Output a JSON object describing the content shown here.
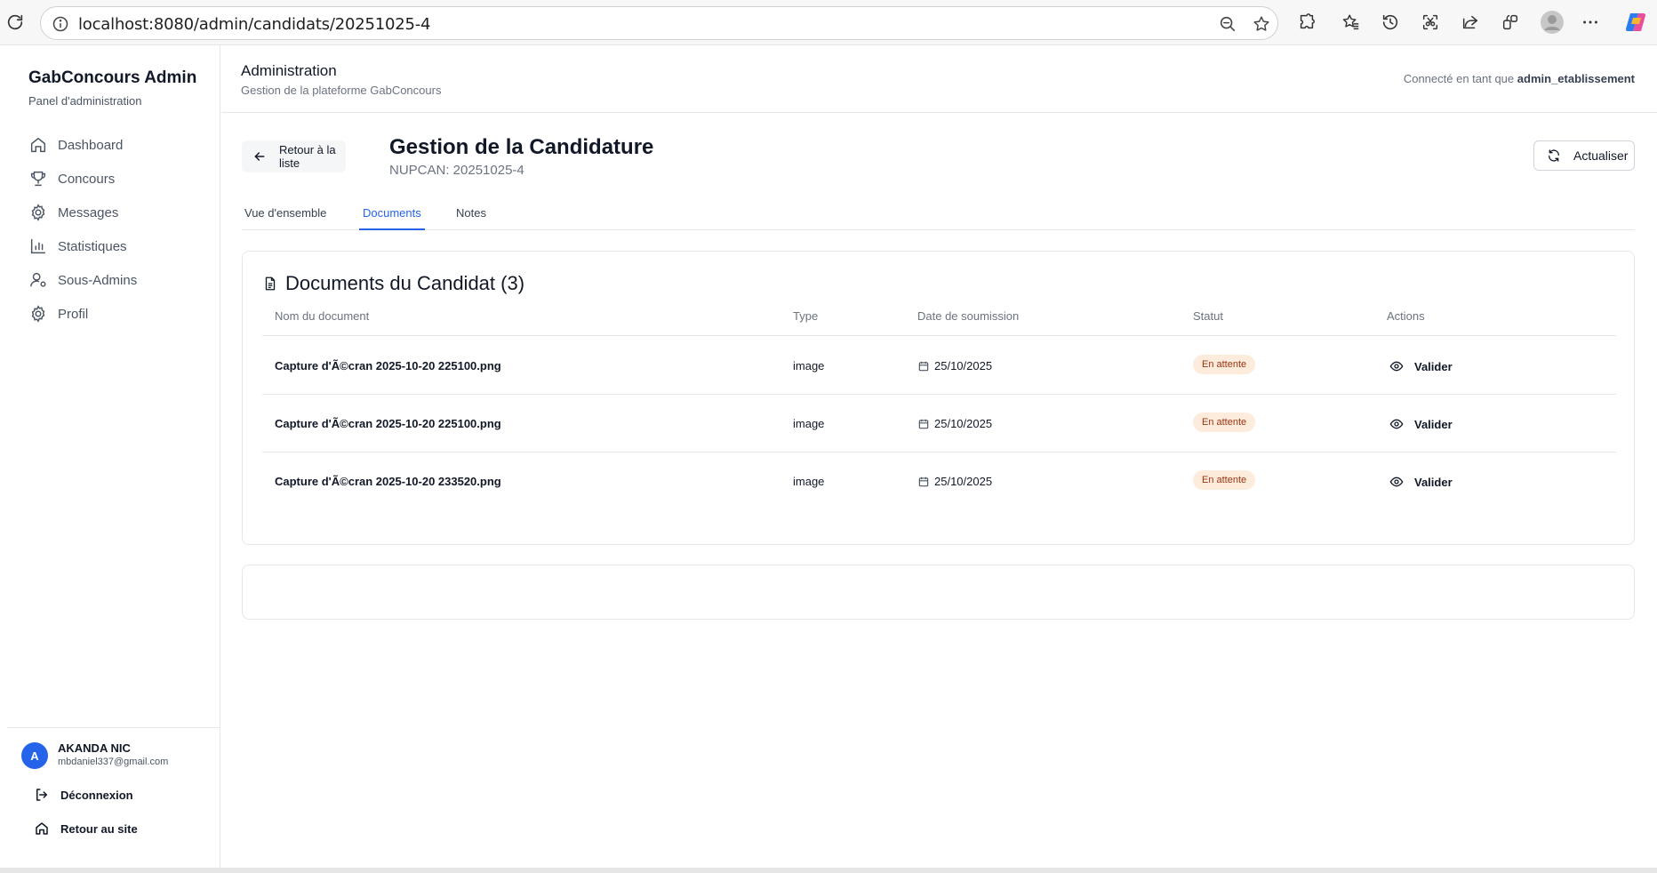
{
  "browser": {
    "url": "localhost:8080/admin/candidats/20251025-4"
  },
  "sidebar": {
    "brand_title": "GabConcours Admin",
    "brand_subtitle": "Panel d'administration",
    "items": [
      {
        "label": "Dashboard",
        "icon": "home-icon"
      },
      {
        "label": "Concours",
        "icon": "trophy-icon"
      },
      {
        "label": "Messages",
        "icon": "gear-icon"
      },
      {
        "label": "Statistiques",
        "icon": "bar-chart-icon"
      },
      {
        "label": "Sous-Admins",
        "icon": "user-cog-icon"
      },
      {
        "label": "Profil",
        "icon": "gear-icon"
      }
    ],
    "user": {
      "initial": "A",
      "name": "AKANDA NIC",
      "email": "mbdaniel337@gmail.com"
    },
    "logout_label": "Déconnexion",
    "back_to_site_label": "Retour au site"
  },
  "header": {
    "title": "Administration",
    "subtitle": "Gestion de la plateforme GabConcours",
    "connected_prefix": "Connecté en tant que",
    "connected_user": "admin_etablissement"
  },
  "page": {
    "back_label": "Retour à la liste",
    "title": "Gestion de la Candidature",
    "subtitle": "NUPCAN: 20251025-4",
    "refresh_label": "Actualiser",
    "tabs": [
      {
        "label": "Vue d'ensemble",
        "active": false
      },
      {
        "label": "Documents",
        "active": true
      },
      {
        "label": "Notes",
        "active": false
      }
    ]
  },
  "documents": {
    "title": "Documents du Candidat (3)",
    "columns": [
      "Nom du document",
      "Type",
      "Date de soumission",
      "Statut",
      "Actions"
    ],
    "rows": [
      {
        "name": "Capture d'Ã©cran 2025-10-20 225100.png",
        "type": "image",
        "date": "25/10/2025",
        "status": "En attente",
        "action": "Valider"
      },
      {
        "name": "Capture d'Ã©cran 2025-10-20 225100.png",
        "type": "image",
        "date": "25/10/2025",
        "status": "En attente",
        "action": "Valider"
      },
      {
        "name": "Capture d'Ã©cran 2025-10-20 233520.png",
        "type": "image",
        "date": "25/10/2025",
        "status": "En attente",
        "action": "Valider"
      }
    ]
  },
  "colors": {
    "accent": "#2563eb",
    "badge_bg": "#fdecdc",
    "badge_text": "#9a3412"
  }
}
